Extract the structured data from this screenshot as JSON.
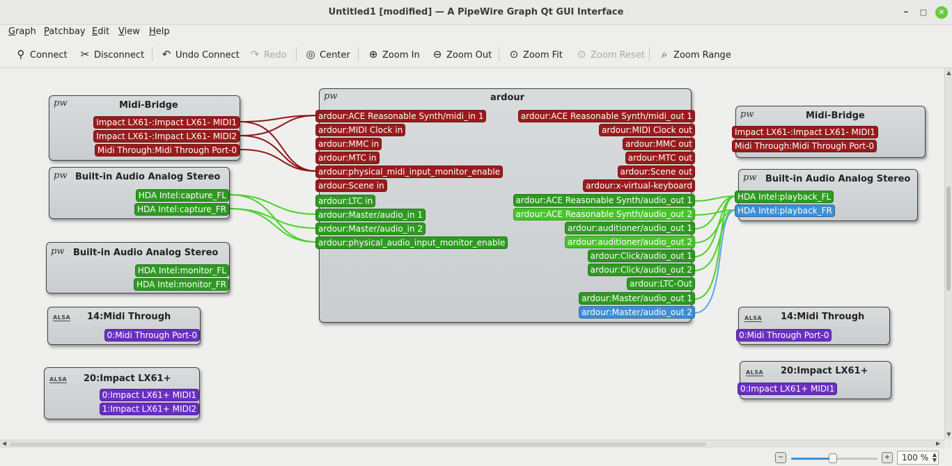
{
  "window": {
    "title": "Untitled1 [modified] — A PipeWire Graph Qt GUI Interface",
    "min": "–",
    "max": "□",
    "close": "✕"
  },
  "menu": [
    {
      "ul": "G",
      "rest": "raph"
    },
    {
      "ul": "P",
      "rest": "atchbay"
    },
    {
      "ul": "E",
      "rest": "dit"
    },
    {
      "ul": "V",
      "rest": "iew"
    },
    {
      "ul": "H",
      "rest": "elp"
    }
  ],
  "toolbar": {
    "connect": "Connect",
    "disconnect": "Disconnect",
    "undo": "Undo Connect",
    "redo": "Redo",
    "center": "Center",
    "zoom_in": "Zoom In",
    "zoom_out": "Zoom Out",
    "zoom_fit": "Zoom Fit",
    "zoom_reset": "Zoom Reset",
    "zoom_range": "Zoom Range"
  },
  "icons": {
    "pw": "pw",
    "alsa": "ALSA"
  },
  "nodes": {
    "midi_bridge_left": {
      "title": "Midi-Bridge",
      "ports": [
        "Impact LX61-:Impact LX61- MIDI1",
        "Impact LX61-:Impact LX61- MIDI2",
        "Midi Through:Midi Through Port-0"
      ]
    },
    "audio_capture": {
      "title": "Built-in Audio Analog Stereo",
      "ports": [
        "HDA Intel:capture_FL",
        "HDA Intel:capture_FR"
      ]
    },
    "audio_monitor": {
      "title": "Built-in Audio Analog Stereo",
      "ports": [
        "HDA Intel:monitor_FL",
        "HDA Intel:monitor_FR"
      ]
    },
    "midi_through_left": {
      "title": "14:Midi Through",
      "ports": [
        "0:Midi Through Port-0"
      ]
    },
    "impact_left": {
      "title": "20:Impact LX61+",
      "ports": [
        "0:Impact LX61+ MIDI1",
        "1:Impact LX61+ MIDI2"
      ]
    },
    "ardour": {
      "title": "ardour",
      "inputs": [
        "ardour:ACE Reasonable Synth/midi_in 1",
        "ardour:MIDI Clock in",
        "ardour:MMC in",
        "ardour:MTC in",
        "ardour:physical_midi_input_monitor_enable",
        "ardour:Scene in",
        "ardour:LTC in",
        "ardour:Master/audio_in 1",
        "ardour:Master/audio_in 2",
        "ardour:physical_audio_input_monitor_enable"
      ],
      "outputs": [
        "ardour:ACE Reasonable Synth/midi_out 1",
        "ardour:MIDI Clock out",
        "ardour:MMC out",
        "ardour:MTC out",
        "ardour:Scene out",
        "ardour:x-virtual-keyboard",
        "ardour:ACE Reasonable Synth/audio_out 1",
        "ardour:ACE Reasonable Synth/audio_out 2",
        "ardour:auditioner/audio_out 1",
        "ardour:auditioner/audio_out 2",
        "ardour:Click/audio_out 1",
        "ardour:Click/audio_out 2",
        "ardour:LTC-Out",
        "ardour:Master/audio_out 1",
        "ardour:Master/audio_out 2"
      ]
    },
    "midi_bridge_right": {
      "title": "Midi-Bridge",
      "ports": [
        "Impact LX61-:Impact LX61- MIDI1",
        "Midi Through:Midi Through Port-0"
      ]
    },
    "audio_playback": {
      "title": "Built-in Audio Analog Stereo",
      "ports": [
        "HDA Intel:playback_FL",
        "HDA Intel:playback_FR"
      ]
    },
    "midi_through_right": {
      "title": "14:Midi Through",
      "ports": [
        "0:Midi Through Port-0"
      ]
    },
    "impact_right": {
      "title": "20:Impact LX61+",
      "ports": [
        "0:Impact LX61+ MIDI1"
      ]
    }
  },
  "status": {
    "zoom": "100 %",
    "zoom_level": 1.0
  },
  "colors": {
    "midi_port": "#9a1b1b",
    "audio_port": "#2f9a22",
    "audio_port_light": "#48c42a",
    "selected_port": "#3b8fd6",
    "alsa_port": "#6a2fc1"
  }
}
